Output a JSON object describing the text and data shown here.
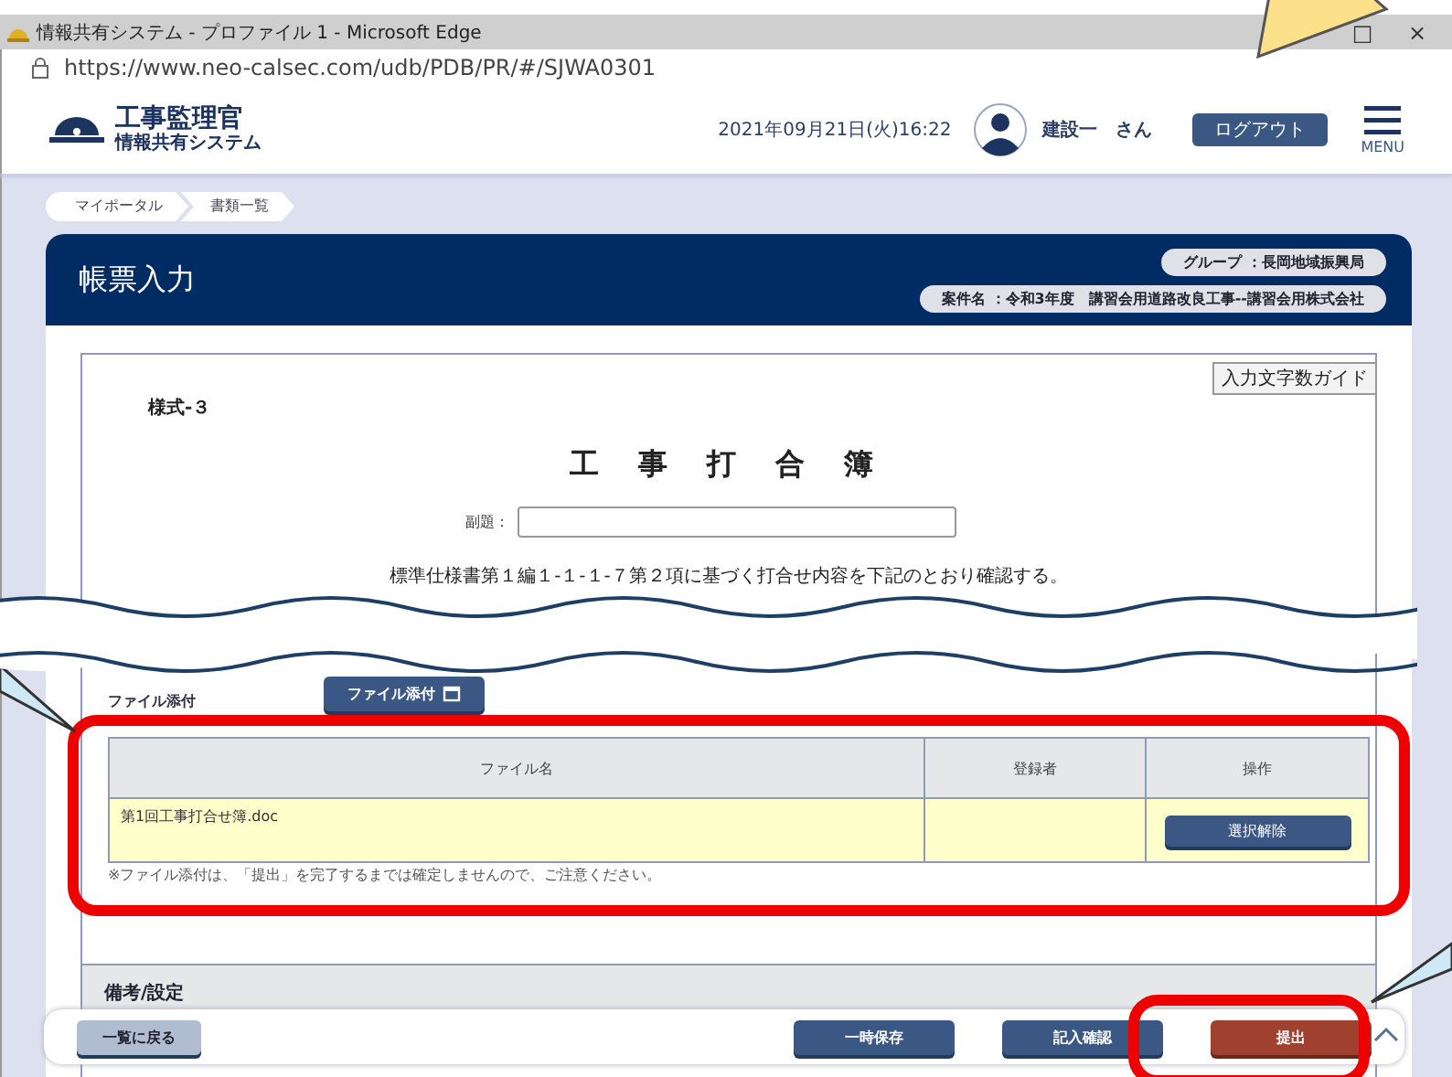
{
  "browser": {
    "title": "情報共有システム - プロファイル 1 - Microsoft Edge",
    "controls": [
      "□",
      "×"
    ],
    "url": "https://www.neo-calsec.com/udb/PDB/PR/#/SJWA0301"
  },
  "app_header": {
    "logo_title": "工事監理官",
    "logo_subtitle": "情報共有システム",
    "datetime": "2021年09月21日(火)16:22",
    "user": "建設一　さん",
    "logout": "ログアウト",
    "menu_label": "MENU"
  },
  "breadcrumbs": [
    "マイポータル",
    "書類一覧"
  ],
  "page": {
    "title": "帳票入力",
    "group": "グループ ：長岡地域振興局",
    "case": "案件名 ：令和3年度　講習会用道路改良工事--講習会用株式会社",
    "guide_button": "入力文字数ガイド"
  },
  "form": {
    "form_no": "様式-３",
    "doc_title": "工 事 打 合 簿",
    "subtitle_label": "副題：",
    "statement": "標準仕様書第１編１-１-１-７第２項に基づく打合せ内容を下記のとおり確認する。"
  },
  "attachments": {
    "label": "ファイル添付",
    "button": "ファイル添付",
    "columns": [
      "ファイル名",
      "登録者",
      "操作"
    ],
    "rows": [
      {
        "file": "第1回工事打合せ簿.doc",
        "registrant": "",
        "action": "選択解除"
      }
    ],
    "note": "※ファイル添付は、「提出」を完了するまでは確定しませんので、ご注意ください。"
  },
  "remarks": {
    "header": "備考/設定"
  },
  "footer": {
    "back": "一覧に戻る",
    "buttons": [
      {
        "label": "一時保存",
        "kind": "primary"
      },
      {
        "label": "記入確認",
        "kind": "primary"
      },
      {
        "label": "提出",
        "kind": "submit"
      }
    ]
  }
}
